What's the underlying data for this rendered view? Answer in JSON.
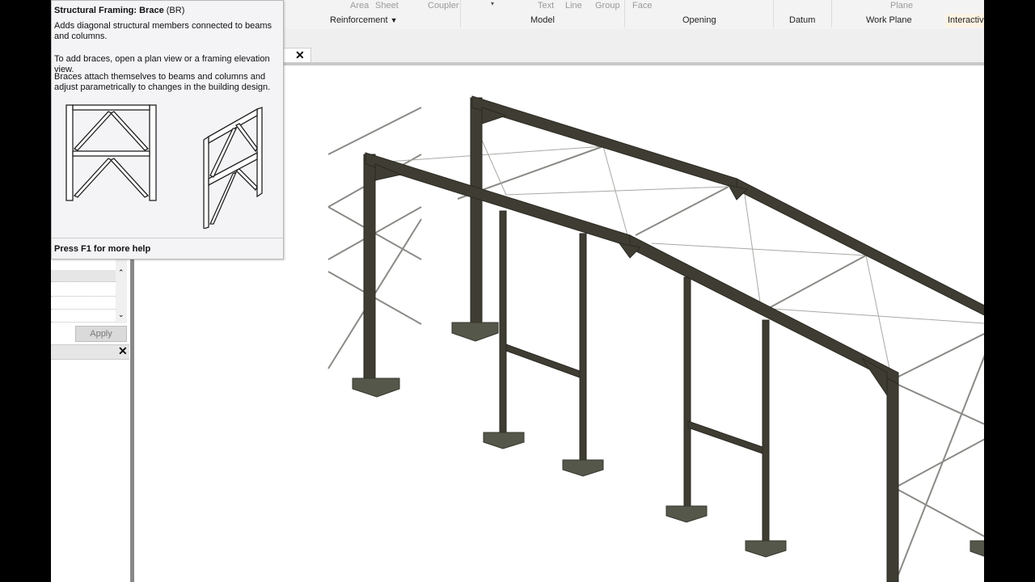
{
  "ribbon": {
    "buttons": [
      "Area",
      "Sheet",
      "Coupler",
      "Text",
      "Line",
      "Group",
      "Face",
      "Plane"
    ],
    "panels": [
      "Reinforcement",
      "Model",
      "Opening",
      "Datum",
      "Work Plane",
      "Interactive"
    ]
  },
  "tooltip": {
    "title": "Structural Framing: Brace",
    "shortcut": "(BR)",
    "description": "Adds diagonal structural members connected to beams and columns.",
    "instruction": "To add braces, open a plan view or a framing elevation view.",
    "detail": "Braces attach themselves to beams and columns and adjust parametrically to changes in the building design.",
    "footer": "Press F1 for more help"
  },
  "view_tab": {
    "close_glyph": "✕"
  },
  "properties": {
    "apply_label": "Apply",
    "close_glyph": "✕"
  },
  "colors": {
    "steel": "#3f3d33",
    "footing": "#55574a",
    "brace": "#8a8a86",
    "ribbon_bg": "#f3f3f3",
    "tooltip_bg": "#f4f4f7"
  }
}
